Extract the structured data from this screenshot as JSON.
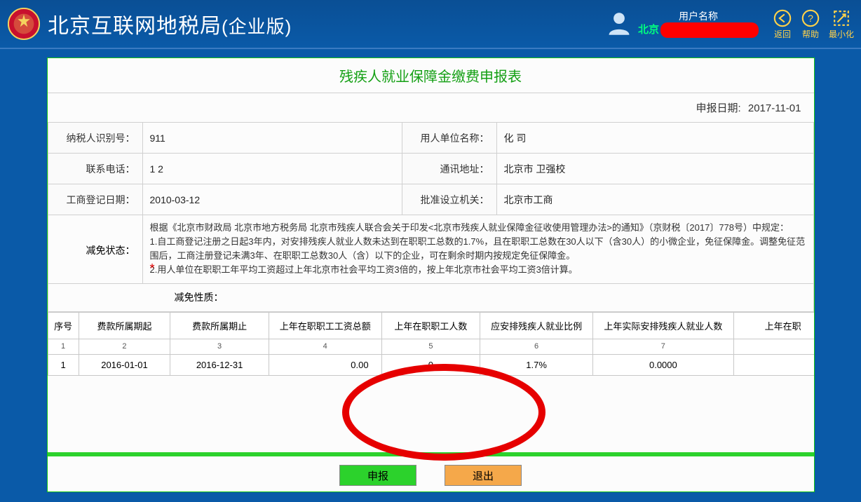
{
  "header": {
    "title_main": "北京互联网地税局",
    "title_sub": "(企业版)",
    "user_label": "用户名称",
    "user_location_prefix": "北京",
    "icons": {
      "back": "返回",
      "help": "帮助",
      "min": "最小化"
    }
  },
  "form": {
    "title": "残疾人就业保障金缴费申报表",
    "report_date_label": "申报日期:",
    "report_date": "2017-11-01",
    "fields": {
      "taxpayer_id_label": "纳税人识别号：",
      "taxpayer_id": "911",
      "employer_name_label": "用人单位名称：",
      "employer_name": "化        司",
      "phone_label": "联系电话：",
      "phone": "1          2",
      "address_label": "通讯地址：",
      "address": "北京市          卫强校",
      "reg_date_label": "工商登记日期：",
      "reg_date": "2010-03-12",
      "approval_org_label": "批准设立机关：",
      "approval_org": "北京市工商"
    },
    "exempt_label": "减免状态：",
    "exempt_text": "根据《北京市财政局 北京市地方税务局 北京市残疾人联合会关于印发<北京市残疾人就业保障金征收使用管理办法>的通知》（京财税〔2017〕778号）中规定：\n1.自工商登记注册之日起3年内，对安排残疾人就业人数未达到在职职工总数的1.7%，且在职职工总数在30人以下（含30人）的小微企业，免征保障金。调整免征范围后，工商注册登记未满3年、在职职工总数30人（含）以下的企业，可在剩余时期内按规定免征保障金。\n2.用人单位在职职工年平均工资超过上年北京市社会平均工资3倍的，按上年北京市社会平均工资3倍计算。",
    "nature_label": "减免性质："
  },
  "grid": {
    "headers": [
      "序号",
      "费款所属期起",
      "费款所属期止",
      "上年在职职工工资总额",
      "上年在职职工人数",
      "应安排残疾人就业比例",
      "上年实际安排残疾人就业人数",
      "上年在职"
    ],
    "col_nums": [
      "1",
      "2",
      "3",
      "4",
      "5",
      "6",
      "7",
      ""
    ],
    "rows": [
      {
        "seq": "1",
        "start": "2016-01-01",
        "end": "2016-12-31",
        "wage": "0.00",
        "count": "0",
        "ratio": "1.7%",
        "actual": "0.0000",
        "last": ""
      }
    ]
  },
  "actions": {
    "submit": "申报",
    "exit": "退出"
  }
}
